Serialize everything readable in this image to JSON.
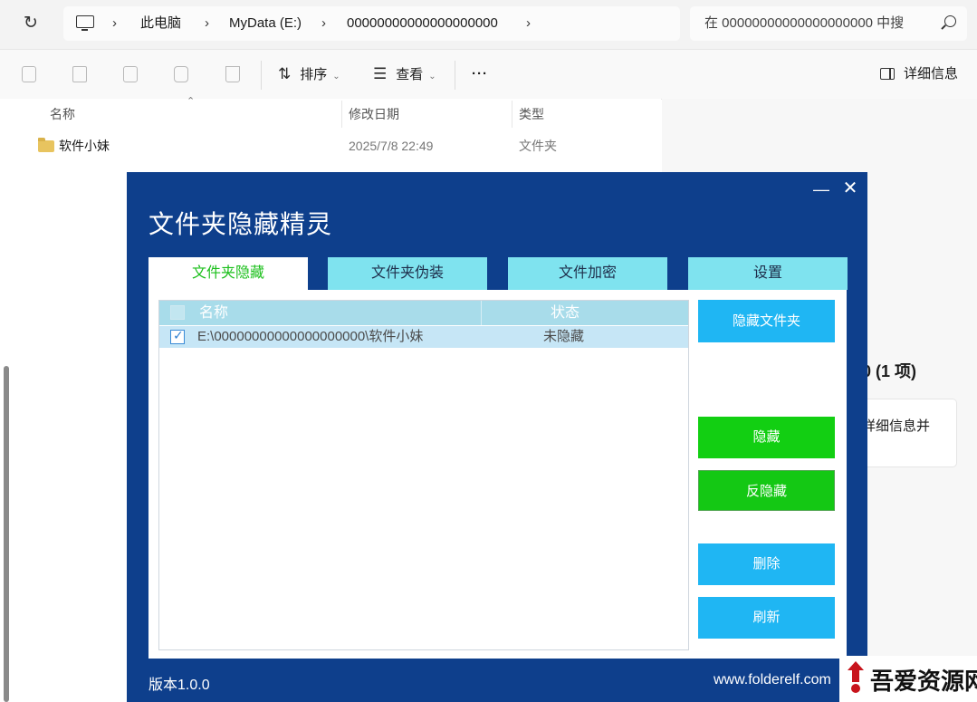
{
  "explorer": {
    "breadcrumb": [
      {
        "label": "此电脑"
      },
      {
        "label": "MyData (E:)"
      },
      {
        "label": "00000000000000000000"
      }
    ],
    "search_placeholder": "在 00000000000000000000 中搜",
    "toolbar": {
      "sort_label": "排序",
      "view_label": "查看",
      "more_label": "···",
      "details_label": "详细信息"
    },
    "columns": {
      "name": "名称",
      "modified": "修改日期",
      "type": "类型"
    },
    "rows": [
      {
        "name": "软件小妹",
        "modified": "2025/7/8 22:49",
        "type": "文件夹"
      }
    ],
    "right_pane": {
      "count_text": "0 (1 项)",
      "card_text": "详细信息并"
    }
  },
  "dialog": {
    "title": "文件夹隐藏精灵",
    "min_glyph": "—",
    "close_glyph": "✕",
    "tabs": [
      {
        "label": "文件夹隐藏",
        "active": true
      },
      {
        "label": "文件夹伪装",
        "active": false
      },
      {
        "label": "文件加密",
        "active": false
      },
      {
        "label": "设置",
        "active": false
      }
    ],
    "list": {
      "header_name": "名称",
      "header_status": "状态",
      "rows": [
        {
          "path": "E:\\00000000000000000000\\软件小妹",
          "status": "未隐藏",
          "checked": true
        }
      ]
    },
    "buttons": {
      "hide_folder": "隐藏文件夹",
      "hide": "隐藏",
      "unhide": "反隐藏",
      "delete": "删除",
      "refresh": "刷新"
    },
    "version": "版本1.0.0",
    "website": "www.folderelf.com"
  },
  "watermark": {
    "text": "吾爱资源网"
  },
  "colors": {
    "dialog_bg": "#0e3f8c",
    "tab_bg": "#7fe3ef",
    "active_tab_text": "#1abf1a",
    "button_blue": "#1fb6f3",
    "button_green": "#12cf12",
    "list_header": "#a8dcea",
    "list_selected_row": "#c6e6f6"
  }
}
